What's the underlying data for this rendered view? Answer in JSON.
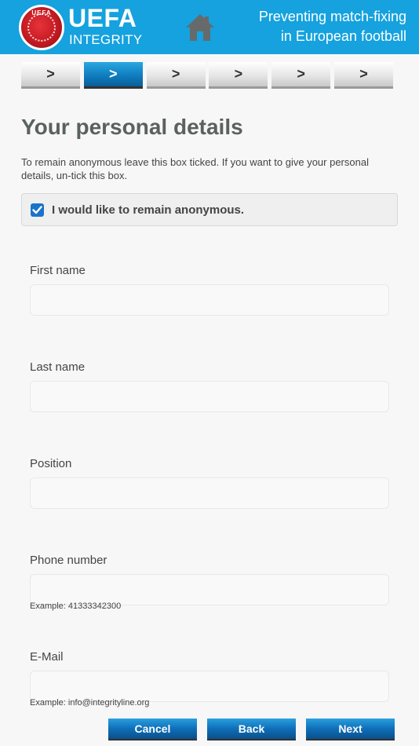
{
  "header": {
    "brand_main": "UEFA",
    "brand_sub": "INTEGRITY",
    "logo_text": "UEFA",
    "tagline_line1": "Preventing match-fixing",
    "tagline_line2": "in European football",
    "home_icon": "home-icon",
    "color": "#15a2de"
  },
  "steps": [
    {
      "label": ">",
      "active": false
    },
    {
      "label": ">",
      "active": true
    },
    {
      "label": ">",
      "active": false
    },
    {
      "label": ">",
      "active": false
    },
    {
      "label": ">",
      "active": false
    },
    {
      "label": ">",
      "active": false
    }
  ],
  "page": {
    "title": "Your personal details",
    "intro": "To remain anonymous leave this box ticked. If you want to give your personal details, un-tick this box.",
    "anonymous_label": "I would like to remain anonymous.",
    "anonymous_checked": true
  },
  "fields": {
    "first_name": {
      "label": "First name",
      "value": ""
    },
    "last_name": {
      "label": "Last name",
      "value": ""
    },
    "position": {
      "label": "Position",
      "value": ""
    },
    "phone": {
      "label": "Phone number",
      "value": "",
      "hint": "Example: 41333342300"
    },
    "email": {
      "label": "E-Mail",
      "value": "",
      "hint": "Example: info@integrityline.org"
    }
  },
  "buttons": {
    "cancel": "Cancel",
    "back": "Back",
    "next": "Next"
  },
  "colors": {
    "accent": "#15a2de",
    "button": "#0e6fb8",
    "checkbox": "#1a73c9"
  }
}
